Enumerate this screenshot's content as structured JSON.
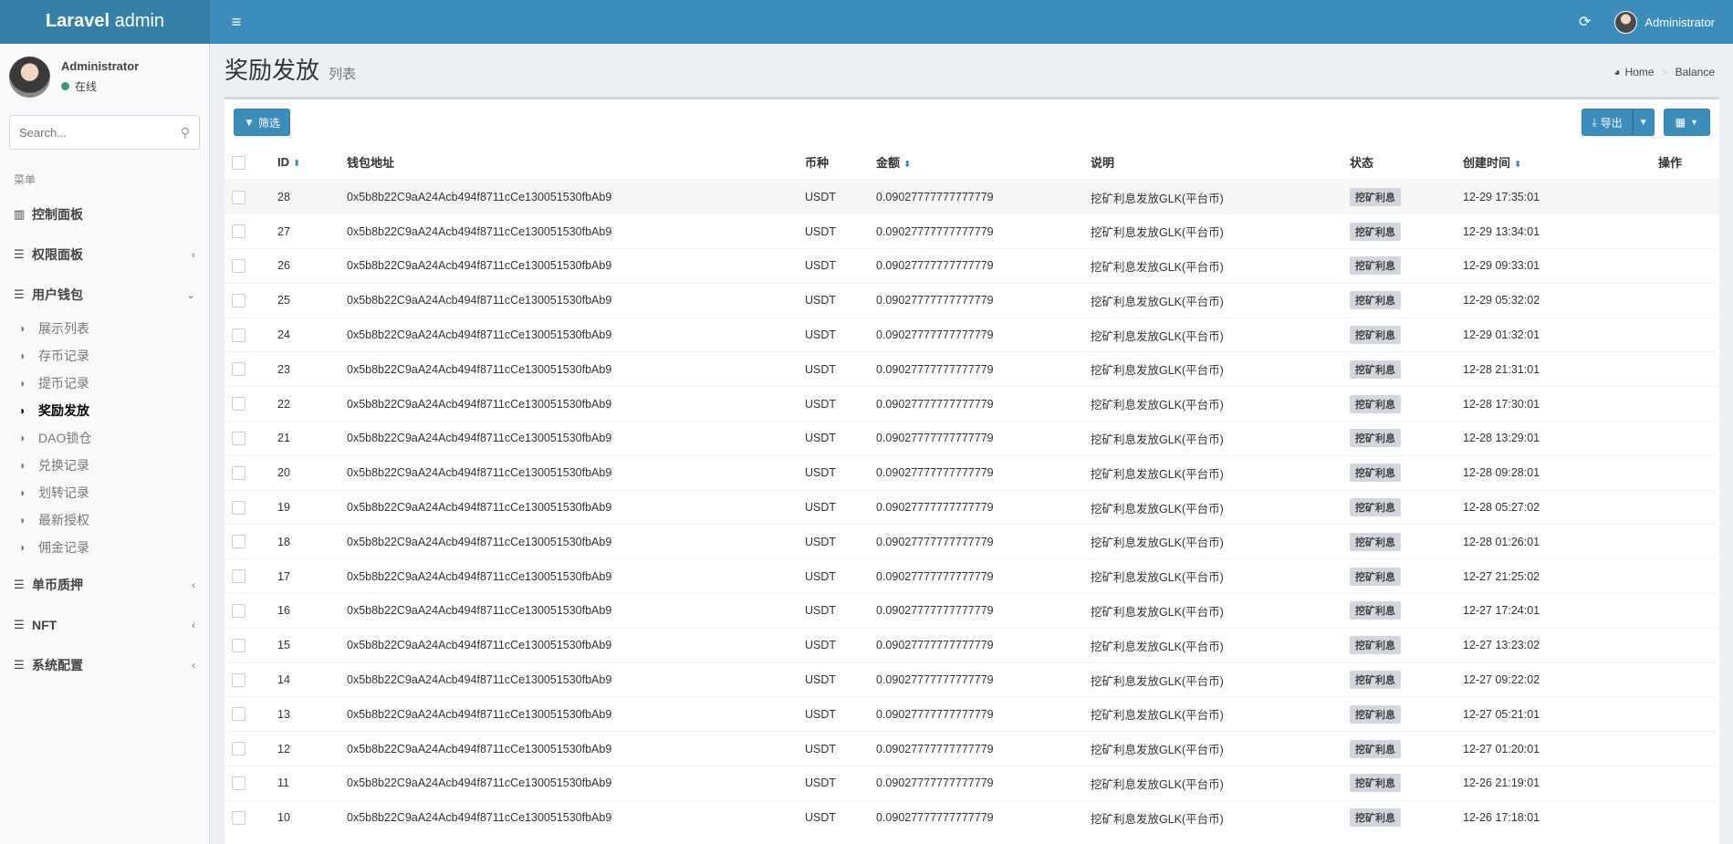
{
  "header": {
    "brand_bold": "Laravel",
    "brand_rest": " admin",
    "menu_toggle_icon": "hamburger-icon",
    "refresh_icon": "refresh-icon",
    "user_name": "Administrator"
  },
  "sidebar": {
    "user_name": "Administrator",
    "user_status": "在线",
    "search_placeholder": "Search...",
    "menu_header": "菜单",
    "items": [
      {
        "label": "控制面板",
        "icon": "bar-chart-icon",
        "arrow": ""
      },
      {
        "label": "权限面板",
        "icon": "tasks-icon",
        "arrow": "‹"
      },
      {
        "label": "用户钱包",
        "icon": "list-icon",
        "arrow": "⌄"
      },
      {
        "label": "单币质押",
        "icon": "list-icon",
        "arrow": "‹"
      },
      {
        "label": "NFT",
        "icon": "list-icon",
        "arrow": "‹"
      },
      {
        "label": "系统配置",
        "icon": "list-icon",
        "arrow": "‹"
      }
    ],
    "subitems": [
      {
        "label": "展示列表"
      },
      {
        "label": "存币记录"
      },
      {
        "label": "提币记录"
      },
      {
        "label": "奖励发放"
      },
      {
        "label": "DAO锁仓"
      },
      {
        "label": "兑换记录"
      },
      {
        "label": "划转记录"
      },
      {
        "label": "最新授权"
      },
      {
        "label": "佣金记录"
      }
    ]
  },
  "page": {
    "title": "奖励发放",
    "subtitle": "列表",
    "breadcrumb_home": "Home",
    "breadcrumb_current": "Balance"
  },
  "toolbar": {
    "filter_label": "筛选",
    "export_label": "导出"
  },
  "table": {
    "columns": {
      "id": "ID",
      "address": "钱包地址",
      "coin": "币种",
      "amount": "金额",
      "description": "说明",
      "status": "状态",
      "created": "创建时间",
      "actions": "操作"
    },
    "rows": [
      {
        "id": "28",
        "address": "0x5b8b22C9aA24Acb494f8711cCe130051530fbAb9",
        "coin": "USDT",
        "amount": "0.09027777777777779",
        "description": "挖矿利息发放GLK(平台币)",
        "status": "挖矿利息",
        "created": "12-29 17:35:01"
      },
      {
        "id": "27",
        "address": "0x5b8b22C9aA24Acb494f8711cCe130051530fbAb9",
        "coin": "USDT",
        "amount": "0.09027777777777779",
        "description": "挖矿利息发放GLK(平台币)",
        "status": "挖矿利息",
        "created": "12-29 13:34:01"
      },
      {
        "id": "26",
        "address": "0x5b8b22C9aA24Acb494f8711cCe130051530fbAb9",
        "coin": "USDT",
        "amount": "0.09027777777777779",
        "description": "挖矿利息发放GLK(平台币)",
        "status": "挖矿利息",
        "created": "12-29 09:33:01"
      },
      {
        "id": "25",
        "address": "0x5b8b22C9aA24Acb494f8711cCe130051530fbAb9",
        "coin": "USDT",
        "amount": "0.09027777777777779",
        "description": "挖矿利息发放GLK(平台币)",
        "status": "挖矿利息",
        "created": "12-29 05:32:02"
      },
      {
        "id": "24",
        "address": "0x5b8b22C9aA24Acb494f8711cCe130051530fbAb9",
        "coin": "USDT",
        "amount": "0.09027777777777779",
        "description": "挖矿利息发放GLK(平台币)",
        "status": "挖矿利息",
        "created": "12-29 01:32:01"
      },
      {
        "id": "23",
        "address": "0x5b8b22C9aA24Acb494f8711cCe130051530fbAb9",
        "coin": "USDT",
        "amount": "0.09027777777777779",
        "description": "挖矿利息发放GLK(平台币)",
        "status": "挖矿利息",
        "created": "12-28 21:31:01"
      },
      {
        "id": "22",
        "address": "0x5b8b22C9aA24Acb494f8711cCe130051530fbAb9",
        "coin": "USDT",
        "amount": "0.09027777777777779",
        "description": "挖矿利息发放GLK(平台币)",
        "status": "挖矿利息",
        "created": "12-28 17:30:01"
      },
      {
        "id": "21",
        "address": "0x5b8b22C9aA24Acb494f8711cCe130051530fbAb9",
        "coin": "USDT",
        "amount": "0.09027777777777779",
        "description": "挖矿利息发放GLK(平台币)",
        "status": "挖矿利息",
        "created": "12-28 13:29:01"
      },
      {
        "id": "20",
        "address": "0x5b8b22C9aA24Acb494f8711cCe130051530fbAb9",
        "coin": "USDT",
        "amount": "0.09027777777777779",
        "description": "挖矿利息发放GLK(平台币)",
        "status": "挖矿利息",
        "created": "12-28 09:28:01"
      },
      {
        "id": "19",
        "address": "0x5b8b22C9aA24Acb494f8711cCe130051530fbAb9",
        "coin": "USDT",
        "amount": "0.09027777777777779",
        "description": "挖矿利息发放GLK(平台币)",
        "status": "挖矿利息",
        "created": "12-28 05:27:02"
      },
      {
        "id": "18",
        "address": "0x5b8b22C9aA24Acb494f8711cCe130051530fbAb9",
        "coin": "USDT",
        "amount": "0.09027777777777779",
        "description": "挖矿利息发放GLK(平台币)",
        "status": "挖矿利息",
        "created": "12-28 01:26:01"
      },
      {
        "id": "17",
        "address": "0x5b8b22C9aA24Acb494f8711cCe130051530fbAb9",
        "coin": "USDT",
        "amount": "0.09027777777777779",
        "description": "挖矿利息发放GLK(平台币)",
        "status": "挖矿利息",
        "created": "12-27 21:25:02"
      },
      {
        "id": "16",
        "address": "0x5b8b22C9aA24Acb494f8711cCe130051530fbAb9",
        "coin": "USDT",
        "amount": "0.09027777777777779",
        "description": "挖矿利息发放GLK(平台币)",
        "status": "挖矿利息",
        "created": "12-27 17:24:01"
      },
      {
        "id": "15",
        "address": "0x5b8b22C9aA24Acb494f8711cCe130051530fbAb9",
        "coin": "USDT",
        "amount": "0.09027777777777779",
        "description": "挖矿利息发放GLK(平台币)",
        "status": "挖矿利息",
        "created": "12-27 13:23:02"
      },
      {
        "id": "14",
        "address": "0x5b8b22C9aA24Acb494f8711cCe130051530fbAb9",
        "coin": "USDT",
        "amount": "0.09027777777777779",
        "description": "挖矿利息发放GLK(平台币)",
        "status": "挖矿利息",
        "created": "12-27 09:22:02"
      },
      {
        "id": "13",
        "address": "0x5b8b22C9aA24Acb494f8711cCe130051530fbAb9",
        "coin": "USDT",
        "amount": "0.09027777777777779",
        "description": "挖矿利息发放GLK(平台币)",
        "status": "挖矿利息",
        "created": "12-27 05:21:01"
      },
      {
        "id": "12",
        "address": "0x5b8b22C9aA24Acb494f8711cCe130051530fbAb9",
        "coin": "USDT",
        "amount": "0.09027777777777779",
        "description": "挖矿利息发放GLK(平台币)",
        "status": "挖矿利息",
        "created": "12-27 01:20:01"
      },
      {
        "id": "11",
        "address": "0x5b8b22C9aA24Acb494f8711cCe130051530fbAb9",
        "coin": "USDT",
        "amount": "0.09027777777777779",
        "description": "挖矿利息发放GLK(平台币)",
        "status": "挖矿利息",
        "created": "12-26 21:19:01"
      },
      {
        "id": "10",
        "address": "0x5b8b22C9aA24Acb494f8711cCe130051530fbAb9",
        "coin": "USDT",
        "amount": "0.09027777777777779",
        "description": "挖矿利息发放GLK(平台币)",
        "status": "挖矿利息",
        "created": "12-26 17:18:01"
      }
    ]
  }
}
